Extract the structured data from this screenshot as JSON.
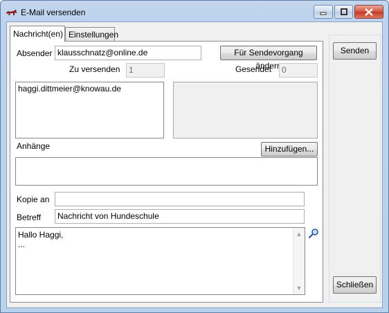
{
  "window": {
    "title": "E-Mail versenden",
    "icon": "dog-app-icon",
    "controls": {
      "minimize": "minimize-icon",
      "maximize": "maximize-icon",
      "close": "close-icon"
    }
  },
  "tabs": [
    {
      "label": "Nachricht(en)",
      "active": true
    },
    {
      "label": "Einstellungen",
      "active": false
    }
  ],
  "form": {
    "absender_label": "Absender",
    "absender_value": "klausschnatz@online.de",
    "change_sender_button": "Für Sendevorgang ändern",
    "zu_versenden_label": "Zu versenden",
    "zu_versenden_value": "1",
    "gesendet_label": "Gesendet",
    "gesendet_value": "0",
    "recipients": [
      "haggi.dittmeier@knowau.de"
    ],
    "anhaenge_label": "Anhänge",
    "add_attachment_button": "Hinzufügen...",
    "kopie_label": "Kopie an",
    "kopie_value": "",
    "betreff_label": "Betreff",
    "betreff_value": "Nachricht von Hundeschule",
    "message_body": "Hallo Haggi,\n..."
  },
  "side": {
    "send_button": "Senden",
    "close_button": "Schließen"
  },
  "colors": {
    "window_frame": "#b9d1ea",
    "close_button": "#c43823",
    "client_bg": "#f0f0f0"
  }
}
